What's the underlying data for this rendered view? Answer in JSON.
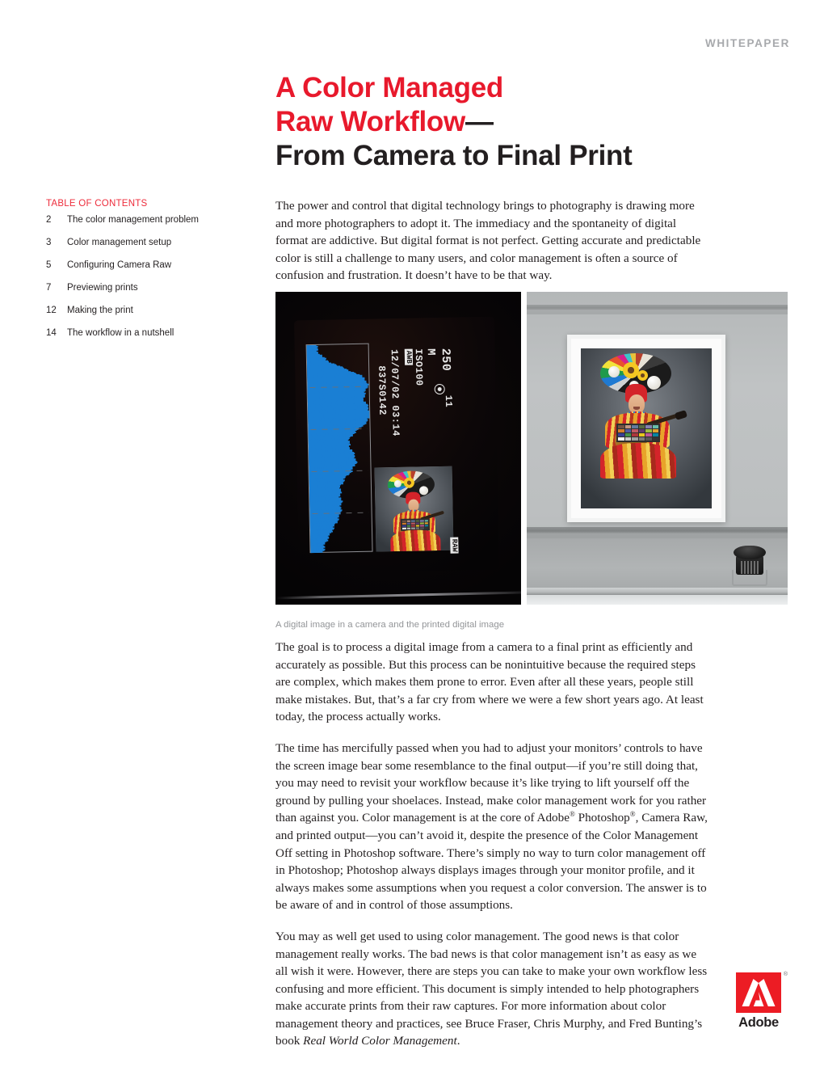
{
  "header": {
    "label": "WHITEPAPER"
  },
  "title": {
    "line1": "A Color Managed",
    "line2": "Raw Workflow",
    "line2_dash": "—",
    "line3": "From Camera to Final Print",
    "accent_color": "#e8192c",
    "dark_color": "#231f20"
  },
  "toc": {
    "heading": "TABLE OF CONTENTS",
    "heading_color": "#ed2c3b",
    "items": [
      {
        "page": "2",
        "label": "The color management problem"
      },
      {
        "page": "3",
        "label": "Color management setup"
      },
      {
        "page": "5",
        "label": "Configuring Camera Raw"
      },
      {
        "page": "7",
        "label": "Previewing prints"
      },
      {
        "page": "12",
        "label": "Making the print"
      },
      {
        "page": "14",
        "label": "The workflow in a nutshell"
      }
    ]
  },
  "body": {
    "intro": "The power and control that digital technology brings to photography is drawing more and more photographers to adopt it. The immediacy and the spontaneity of digital format are addictive. But digital format is not perfect. Getting accurate and predictable color is still a challenge to many users, and color management is often a source of confusion and frustration. It doesn’t have to be that way.",
    "para2": "The goal is to process a digital image from a camera to a final print as efficiently and accurately as possible. But this process can be nonintuitive because the required steps are complex, which makes them prone to error. Even after all these years, people still make mistakes. But, that’s a far cry from where we were a few short years ago. At least today, the process actually works.",
    "para3_a": "The time has mercifully passed when you had to adjust your monitors’ controls to have the screen image bear some resemblance to the final output—if you’re still doing that, you may need to revisit your workflow because it’s like trying to lift yourself off the ground by pulling your shoelaces. Instead, make color management work for you rather than against you. Color management is at the core of Adobe",
    "para3_reg1": "®",
    "para3_b": " Photoshop",
    "para3_reg2": "®",
    "para3_c": ", Camera Raw, and printed output—you can’t avoid it, despite the presence of the Color Management Off setting in Photoshop software. There’s simply no way to turn color management off in Photoshop; Photoshop always displays images through your monitor profile, and it always makes some assumptions when you request a color conversion. The answer is to be aware of and in control of those assumptions.",
    "para4_a": "You may as well get used to using color management. The good news is that color management really works. The bad news is that color management isn’t as easy as we all wish it were. However, there are steps you can take to make your own workflow less confusing and more efficient. This document is simply intended to help photographers make accurate prints from their raw captures. For more information about color management theory and practices, see Bruce Fraser, Chris Murphy, and Fred Bunting’s book ",
    "para4_book": "Real World Color Management",
    "para4_end": "."
  },
  "figure": {
    "caption": "A digital image in a camera and the printed digital image",
    "left_photo": {
      "description": "camera-lcd-playback-screen",
      "shutter_speed": "250",
      "mode": "M",
      "iso": "ISO100",
      "white_balance": "AWB",
      "datetime": "12/07/02 03:14",
      "filename": "837S0142",
      "frame_number": "11",
      "format_badge": "RAW",
      "histogram_color": "#1a7fd4"
    },
    "right_photo": {
      "description": "framed-print-on-gray-wall-with-colorimeter"
    }
  },
  "logo": {
    "wordmark": "Adobe",
    "registered": "®",
    "red": "#ec1c24"
  }
}
